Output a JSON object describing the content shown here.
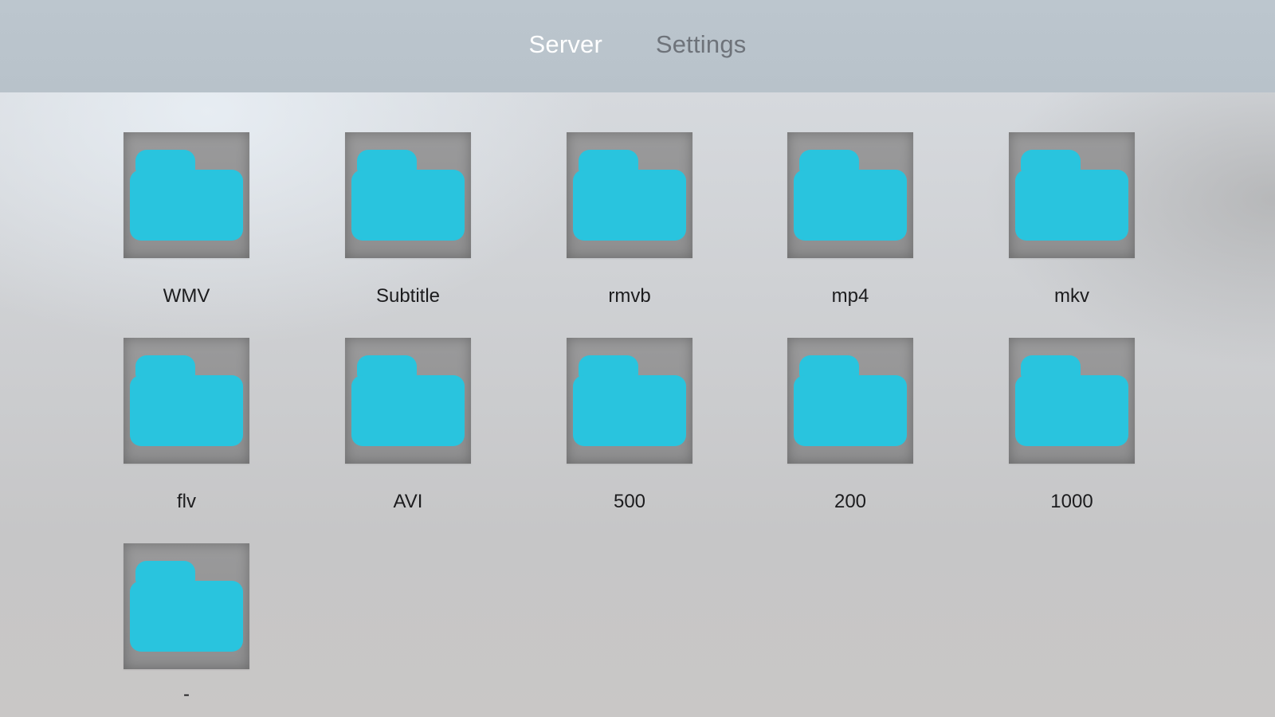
{
  "tabs": [
    {
      "label": "Server",
      "active": true
    },
    {
      "label": "Settings",
      "active": false
    }
  ],
  "folders": [
    {
      "name": "WMV"
    },
    {
      "name": "Subtitle"
    },
    {
      "name": "rmvb"
    },
    {
      "name": "mp4"
    },
    {
      "name": "mkv"
    },
    {
      "name": "flv"
    },
    {
      "name": "AVI"
    },
    {
      "name": "500"
    },
    {
      "name": "200"
    },
    {
      "name": "1000"
    },
    {
      "name": "-"
    }
  ],
  "colors": {
    "folder": "#29c4de",
    "tab_active": "#ffffff",
    "tab_inactive": "#6e737a"
  },
  "icons": {
    "folder": "folder-icon"
  }
}
